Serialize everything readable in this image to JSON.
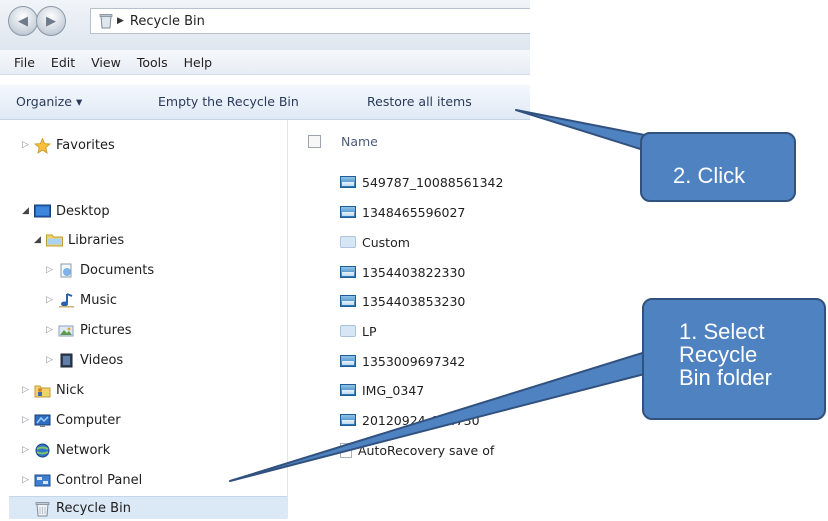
{
  "window": {
    "address_path": "Recycle Bin"
  },
  "menu": [
    "File",
    "Edit",
    "View",
    "Tools",
    "Help"
  ],
  "command_bar": {
    "organize": "Organize ▾",
    "empty": "Empty the Recycle Bin",
    "restore": "Restore all items"
  },
  "nav": {
    "favorites": "Favorites",
    "desktop": "Desktop",
    "libraries": "Libraries",
    "documents": "Documents",
    "music": "Music",
    "pictures": "Pictures",
    "videos": "Videos",
    "nick": "Nick",
    "computer": "Computer",
    "network": "Network",
    "control_panel": "Control Panel",
    "recycle_bin": "Recycle Bin"
  },
  "file_list": {
    "column_header": "Name",
    "files": [
      {
        "name": "549787_10088561342",
        "icon": "picture-icon"
      },
      {
        "name": "1348465596027",
        "icon": "picture-icon"
      },
      {
        "name": "Custom",
        "icon": "generic-file-icon"
      },
      {
        "name": "1354403822330",
        "icon": "picture-icon"
      },
      {
        "name": "1354403853230",
        "icon": "picture-icon"
      },
      {
        "name": "LP",
        "icon": "generic-file-icon"
      },
      {
        "name": "1353009697342",
        "icon": "picture-icon"
      },
      {
        "name": "IMG_0347",
        "icon": "picture-icon"
      },
      {
        "name": "20120924_154730",
        "icon": "picture-icon"
      },
      {
        "name": "AutoRecovery save of",
        "icon": "document-icon"
      }
    ]
  },
  "callouts": {
    "click": "2. Click",
    "select": [
      "1. Select",
      "Recycle",
      "Bin folder"
    ]
  },
  "colors": {
    "callout_fill": "#4f82c0",
    "callout_border": "#31517e",
    "selection": "#dbe8f6"
  }
}
